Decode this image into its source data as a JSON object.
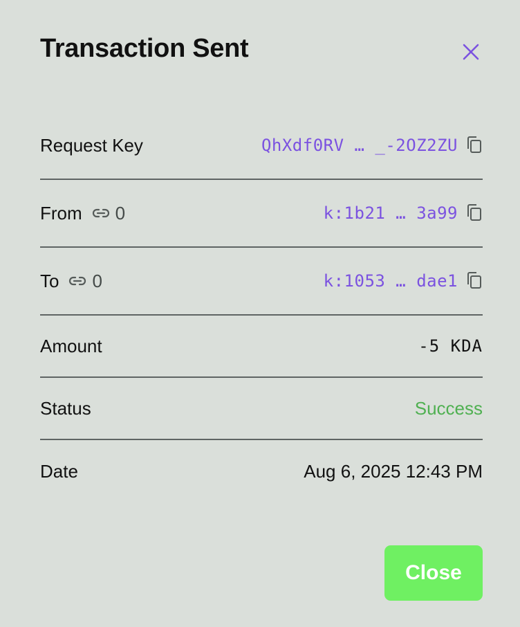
{
  "dialog": {
    "title": "Transaction Sent",
    "close_button_label": "Close"
  },
  "rows": {
    "request_key": {
      "label": "Request Key",
      "value": "QhXdf0RV … _-2OZ2ZU"
    },
    "from": {
      "label": "From",
      "link_count": "0",
      "value": "k:1b21 … 3a99"
    },
    "to": {
      "label": "To",
      "link_count": "0",
      "value": "k:1053 … dae1"
    },
    "amount": {
      "label": "Amount",
      "value": "-5 KDA"
    },
    "status": {
      "label": "Status",
      "value": "Success"
    },
    "date": {
      "label": "Date",
      "value": "Aug 6, 2025 12:43 PM"
    }
  },
  "colors": {
    "background": "#dadfda",
    "accent_purple": "#7b52e0",
    "success_green": "#4fb051",
    "button_green": "#6ff062",
    "divider": "#5e6463"
  },
  "icons": {
    "close": "close-icon",
    "copy": "copy-icon",
    "link": "link-icon"
  }
}
